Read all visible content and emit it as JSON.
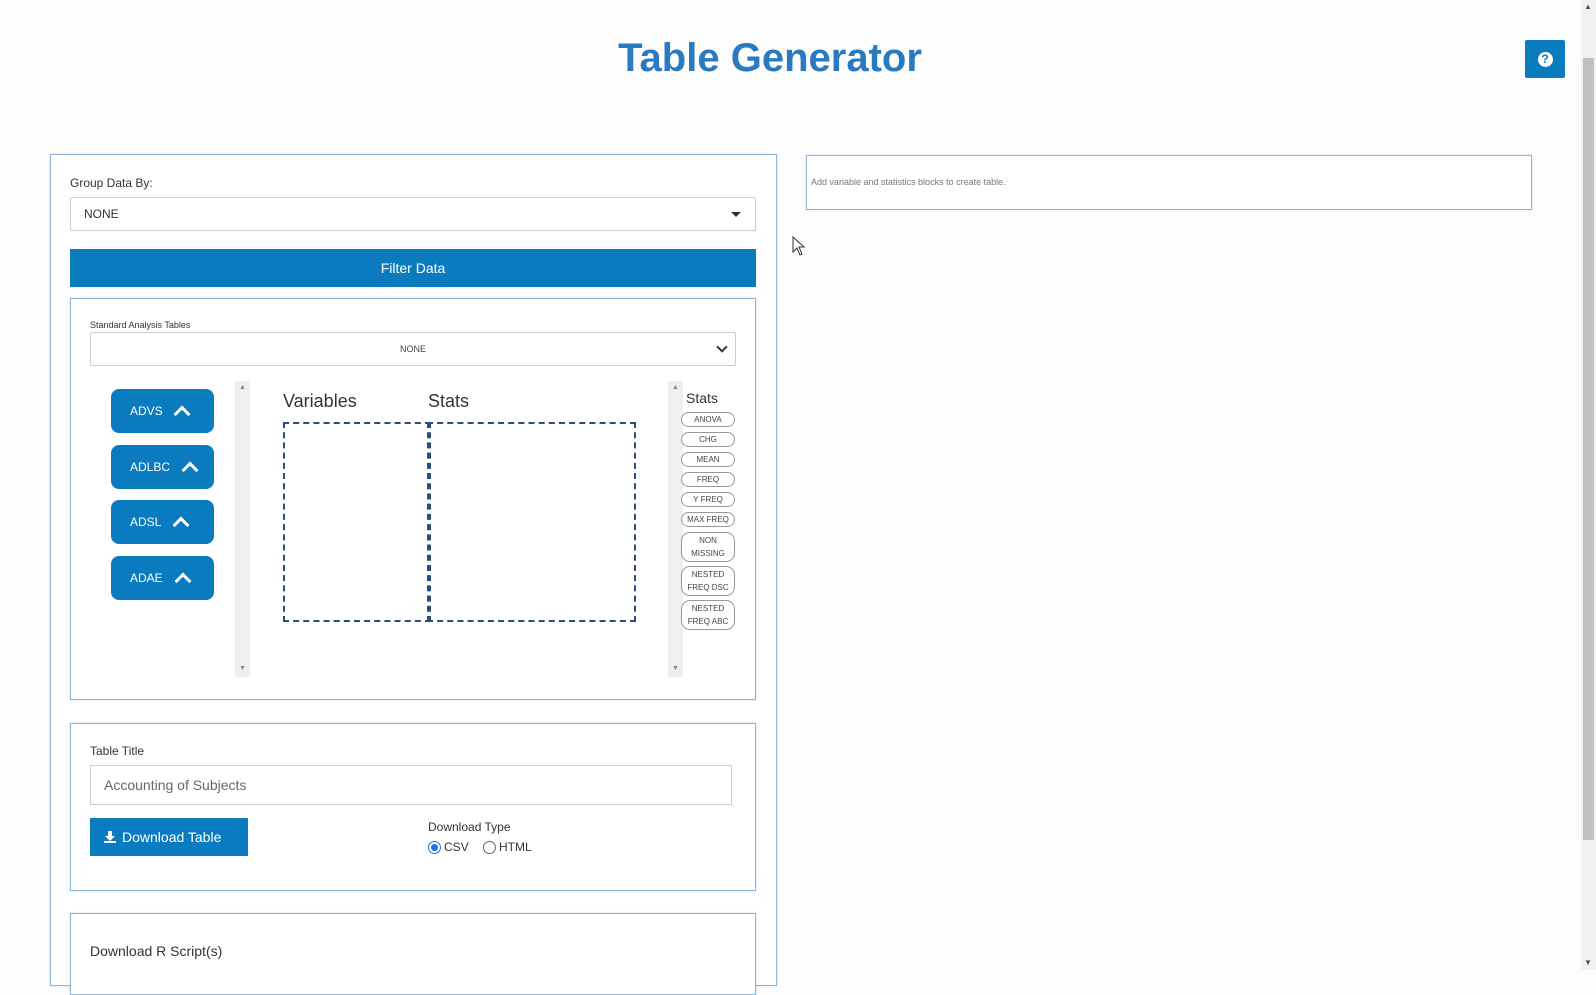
{
  "header": {
    "title": "Table Generator",
    "help_icon": "question-circle-icon",
    "help_glyph": "?"
  },
  "grouping": {
    "label": "Group Data By:",
    "value": "NONE"
  },
  "filter": {
    "label": "Filter Data"
  },
  "analysis": {
    "sat_label": "Standard Analysis Tables",
    "sat_value": "NONE",
    "datasets": [
      "ADVS",
      "ADLBC",
      "ADSL",
      "ADAE"
    ],
    "variables_header": "Variables",
    "stats_header": "Stats",
    "stats_panel_title": "Stats",
    "stats_blocks": [
      "ANOVA",
      "CHG",
      "MEAN",
      "FREQ",
      "Y FREQ",
      "MAX FREQ",
      "NON MISSING",
      "NESTED FREQ DSC",
      "NESTED FREQ ABC"
    ]
  },
  "output": {
    "title_label": "Table Title",
    "title_placeholder": "Accounting of Subjects",
    "download_label": "Download Table",
    "download_type_label": "Download Type",
    "type_options": [
      "CSV",
      "HTML"
    ],
    "selected_type": "CSV"
  },
  "scripts": {
    "label": "Download R Script(s)"
  },
  "preview": {
    "message": "Add variable and statistics blocks to create table."
  },
  "colors": {
    "accent": "#0a7bbf",
    "title": "#2a7ac0",
    "panel_border": "#8bb6d9"
  }
}
